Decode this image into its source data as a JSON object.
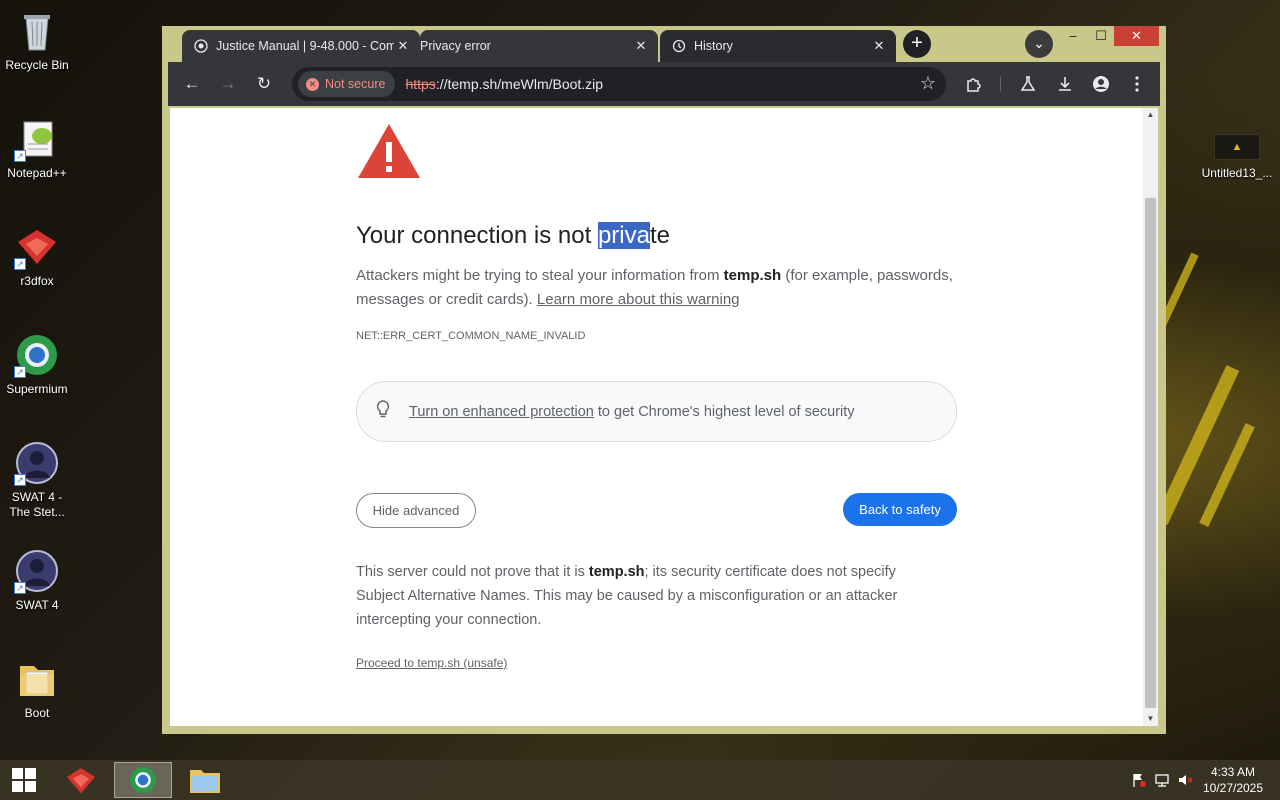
{
  "desktop": {
    "icons": [
      {
        "label": "Recycle Bin"
      },
      {
        "label": "Notepad++"
      },
      {
        "label": "r3dfox"
      },
      {
        "label": "Supermium"
      },
      {
        "label": "SWAT 4 -\nThe Stet..."
      },
      {
        "label": "SWAT 4"
      },
      {
        "label": "Boot"
      }
    ],
    "right_icon_label": "Untitled13_..."
  },
  "browser": {
    "tabs": [
      {
        "title": "Justice Manual | 9-48.000 - Com",
        "icon": "globe-icon"
      },
      {
        "title": "Privacy error",
        "icon": "error-icon"
      },
      {
        "title": "History",
        "icon": "history-icon"
      }
    ],
    "new_tab": "+",
    "tab_search": "⌄",
    "window_controls": {
      "minimize": "–",
      "maximize": "☐",
      "close": "✕"
    },
    "toolbar": {
      "back": "←",
      "forward": "→",
      "reload": "↻",
      "not_secure": "Not secure",
      "url_scheme": "https",
      "url_rest": "://temp.sh/meWlm/Boot.zip",
      "bookmark": "☆"
    }
  },
  "error_page": {
    "heading_before": "Your connection is not ",
    "heading_selected": "priva",
    "heading_after": "te",
    "p1_before": "Attackers might be trying to steal your information from ",
    "p1_host": "temp.sh",
    "p1_after": " (for example, passwords, messages or credit cards). ",
    "p1_link": "Learn more about this warning",
    "error_code": "NET::ERR_CERT_COMMON_NAME_INVALID",
    "enhanced_link": "Turn on enhanced protection",
    "enhanced_rest": " to get Chrome's highest level of security",
    "hide_advanced": "Hide advanced",
    "back_to_safety": "Back to safety",
    "p2_before": "This server could not prove that it is ",
    "p2_host": "temp.sh",
    "p2_after": "; its security certificate does not specify Subject Alternative Names. This may be caused by a misconfiguration or an attacker intercepting your connection.",
    "proceed": "Proceed to temp.sh (unsafe)"
  },
  "taskbar": {
    "time": "4:33 AM",
    "date": "10/27/2025"
  },
  "colors": {
    "accent": "#1a73e8",
    "warning_red": "#db4437",
    "selection": "#3b68c7"
  }
}
